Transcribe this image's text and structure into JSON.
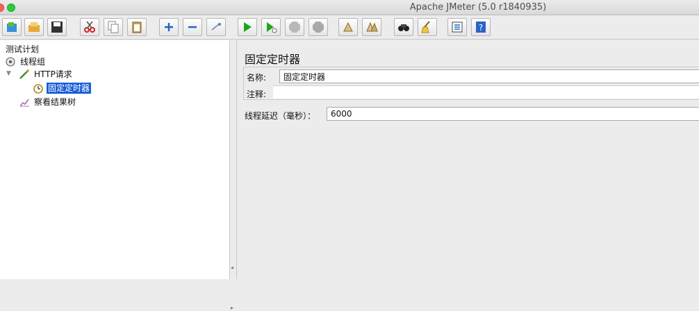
{
  "window": {
    "title": "Apache JMeter (5.0 r1840935)"
  },
  "toolbar": {
    "icons": [
      "templates-icon",
      "open-icon",
      "save-icon",
      "cut-icon",
      "copy-icon",
      "paste-icon",
      "expand-icon",
      "collapse-icon",
      "toggle-icon",
      "start-icon",
      "start-no-pause-icon",
      "stop-icon",
      "shutdown-icon",
      "clear-icon",
      "clear-all-icon",
      "search-icon",
      "reset-search-icon",
      "function-helper-icon",
      "help-icon"
    ]
  },
  "tree": {
    "nodes": [
      {
        "label": "测试计划",
        "icon": "test-plan-icon"
      },
      {
        "label": "线程组",
        "icon": "thread-group-icon"
      },
      {
        "label": "HTTP请求",
        "icon": "http-sampler-icon"
      },
      {
        "label": "固定定时器",
        "icon": "timer-icon",
        "selected": true
      },
      {
        "label": "察看结果树",
        "icon": "results-tree-icon"
      }
    ]
  },
  "panel": {
    "title": "固定定时器",
    "name_label": "名称:",
    "name_value": "固定定时器",
    "comment_label": "注释:",
    "comment_value": "",
    "delay_label": "线程延迟（毫秒）：",
    "delay_value": "6000"
  },
  "colors": {
    "selection": "#1b5ed6",
    "start_green": "#1aa81a"
  }
}
